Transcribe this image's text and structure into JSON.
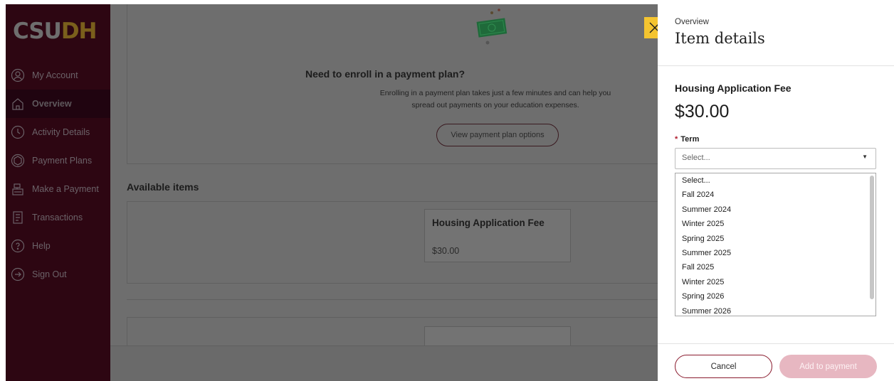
{
  "sidebar": {
    "logo_prefix": "CSU",
    "logo_suffix": "DH",
    "items": [
      {
        "label": "My Account",
        "icon": "user-circle-icon"
      },
      {
        "label": "Overview",
        "icon": "home-icon"
      },
      {
        "label": "Activity Details",
        "icon": "clock-icon"
      },
      {
        "label": "Payment Plans",
        "icon": "hexagon-icon"
      },
      {
        "label": "Make a Payment",
        "icon": "register-icon"
      },
      {
        "label": "Transactions",
        "icon": "receipt-icon"
      },
      {
        "label": "Help",
        "icon": "help-icon"
      },
      {
        "label": "Sign Out",
        "icon": "sign-out-icon"
      }
    ],
    "active": "Overview"
  },
  "main": {
    "promo": {
      "title": "Need to enroll in a payment plan?",
      "text_line1": "Enrolling in a payment plan takes just a few minutes and can help you",
      "text_line2": "spread out payments on your education expenses.",
      "button": "View payment plan options"
    },
    "available_items_title": "Available items",
    "items": [
      {
        "name": "Housing Application Fee",
        "price": "$30.00"
      }
    ]
  },
  "drawer": {
    "kicker": "Overview",
    "title": "Item details",
    "item_name": "Housing Application Fee",
    "price": "$30.00",
    "term_label": "Term",
    "required_mark": "*",
    "select_value": "Select...",
    "options": [
      "Select...",
      "Fall 2024",
      "Summer 2024",
      "Winter 2025",
      "Spring 2025",
      "Summer 2025",
      "Fall 2025",
      "Winter 2025",
      "Spring 2026",
      "Summer 2026"
    ],
    "cancel_label": "Cancel",
    "add_label": "Add to payment"
  },
  "colors": {
    "brand": "#8a1b2e",
    "close_tab": "#f4c430",
    "add_disabled": "#e7b7c1"
  }
}
